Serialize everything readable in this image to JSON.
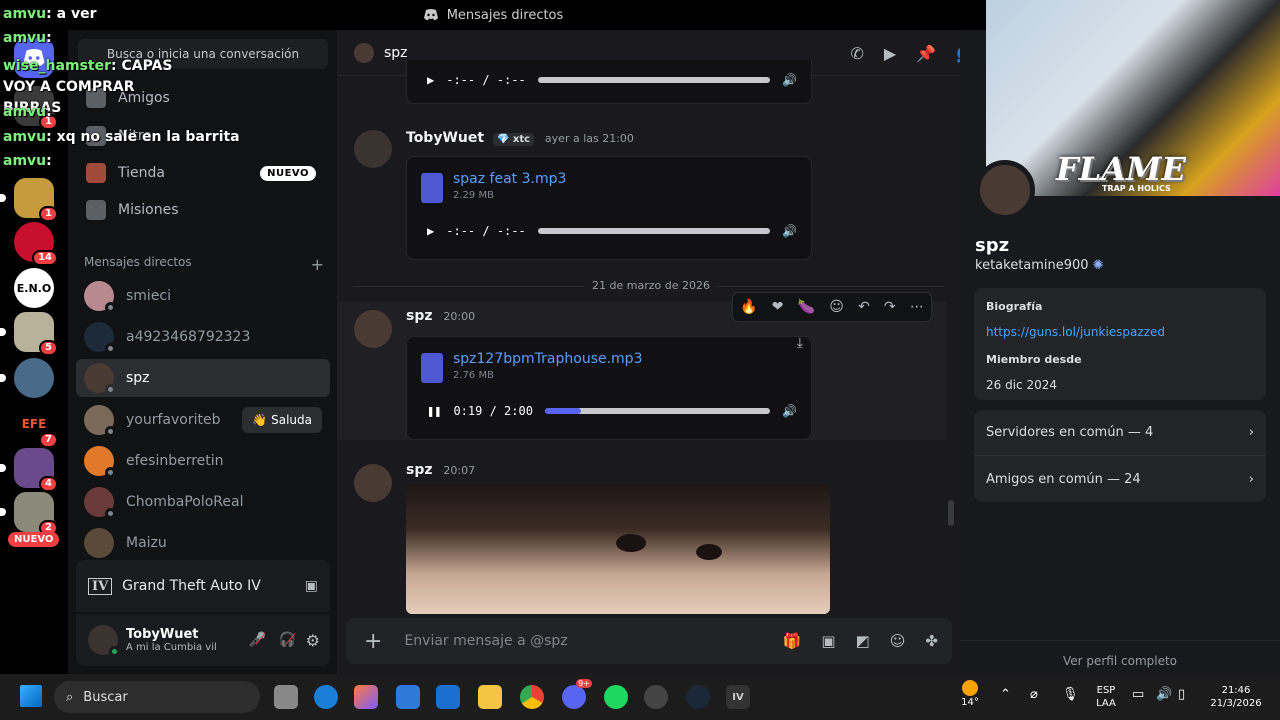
{
  "window": {
    "title": "Mensajes directos"
  },
  "search": {
    "placeholder": "Busca o inicia una conversación"
  },
  "nav": [
    {
      "label": "Amigos"
    },
    {
      "label": "Nitro"
    },
    {
      "label": "Tienda",
      "badge": "NUEVO"
    },
    {
      "label": "Misiones"
    }
  ],
  "dm_section": {
    "title": "Mensajes directos",
    "add": "+"
  },
  "dms": [
    {
      "name": "smieci"
    },
    {
      "name": "a4923468792323"
    },
    {
      "name": "spz"
    },
    {
      "name": "yourfavoriteb",
      "action": "Saluda"
    },
    {
      "name": "efesinberretin"
    },
    {
      "name": "ChombaPoloReal"
    },
    {
      "name": "Maizu"
    }
  ],
  "servers": [
    {
      "badge": "1"
    },
    {
      "badge": "14"
    },
    {
      "badge": ""
    },
    {
      "badge": "5"
    },
    {
      "badge": ""
    },
    {
      "badge": "7"
    },
    {
      "badge": "4"
    },
    {
      "badge": "2",
      "tag": "NUEVO"
    }
  ],
  "activity": {
    "game": "Grand Theft Auto IV"
  },
  "user_panel": {
    "name": "TobyWuet",
    "status": "A mi la Cumbia vill"
  },
  "chat": {
    "channel": "spz",
    "date_divider": "21 de marzo de 2026",
    "messages": [
      {
        "author": "TobyWuet",
        "tag": "xtc",
        "time": "ayer a las 21:00",
        "file": "spaz feat 3.mp3",
        "size": "2.29 MB",
        "current": "-:--",
        "duration": "-:--",
        "progress": 0
      },
      {
        "author": "spz",
        "time": "20:00",
        "file": "spz127bpmTraphouse.mp3",
        "size": "2.76 MB",
        "current": "0:19",
        "duration": "2:00",
        "progress": 0.16
      },
      {
        "author": "spz",
        "time": "20:07"
      }
    ],
    "composer_placeholder": "Enviar mensaje a @spz"
  },
  "profile": {
    "display_name": "spz",
    "username": "ketaketamine900",
    "bio_label": "Biografía",
    "bio_link": "https://guns.lol/junkiespazzed",
    "member_label": "Miembro desde",
    "member_since": "26 dic 2024",
    "servers_common": "Servidores en común — 4",
    "friends_common": "Amigos en común — 24",
    "view_full": "Ver perfil completo"
  },
  "stream_overlay": {
    "banner_text": "FLAME",
    "banner_sub": "TRAP A HOLICS",
    "chat": [
      {
        "user": "amvu",
        "text": "a ver"
      },
      {
        "user": "amvu",
        "text": ""
      },
      {
        "user": "wise_hamster",
        "text": "CAPAS VOY A COMPRAR BIRRAS"
      },
      {
        "user": "amvu",
        "text": ""
      },
      {
        "user": "amvu",
        "text": "xq no sale en la barrita"
      },
      {
        "user": "amvu",
        "text": ""
      }
    ]
  },
  "taskbar": {
    "search": "Buscar",
    "weather": "14°",
    "lang": "ESP",
    "lang2": "LAA",
    "time": "21:46",
    "date": "21/3/2026",
    "discord_badge": "9+"
  }
}
